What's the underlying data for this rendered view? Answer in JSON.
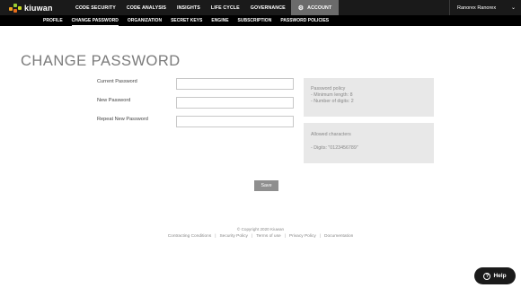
{
  "header": {
    "logo": "kiuwan",
    "nav": [
      {
        "label": "CODE SECURITY"
      },
      {
        "label": "CODE ANALYSIS"
      },
      {
        "label": "INSIGHTS"
      },
      {
        "label": "LIFE CYCLE"
      },
      {
        "label": "GOVERNANCE"
      }
    ],
    "account_label": "ACCOUNT",
    "user_name": "Ranorex Ranorex"
  },
  "subnav": [
    {
      "label": "PROFILE"
    },
    {
      "label": "CHANGE PASSWORD"
    },
    {
      "label": "ORGANIZATION"
    },
    {
      "label": "SECRET KEYS"
    },
    {
      "label": "ENGINE"
    },
    {
      "label": "SUBSCRIPTION"
    },
    {
      "label": "PASSWORD POLICIES"
    }
  ],
  "page": {
    "title": "CHANGE PASSWORD"
  },
  "form": {
    "current_label": "Current Password",
    "current_value": "",
    "new_label": "New Password",
    "new_value": "",
    "repeat_label": "Repeat New Password",
    "repeat_value": "",
    "save_label": "Save"
  },
  "policy": {
    "heading": "Password policy",
    "min_length": "- Minimum length: 8",
    "num_digits": "- Number of digits: 2"
  },
  "allowed": {
    "heading": "Allowed characters",
    "digits": "- Digits: \"0123456789\""
  },
  "footer": {
    "copyright": "© Copyright 2020 Kiuwan",
    "links": [
      "Contracting Conditions",
      "Security Policy",
      "Terms of use",
      "Privacy Policy",
      "Documentation"
    ]
  },
  "help": {
    "label": "Help"
  }
}
